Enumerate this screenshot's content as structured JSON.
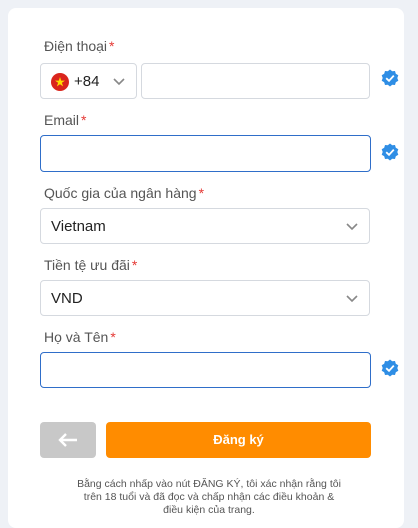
{
  "form": {
    "phone": {
      "label": "Điện thoại",
      "required_mark": "*",
      "country_code": "+84",
      "value": ""
    },
    "email": {
      "label": "Email",
      "required_mark": "*",
      "value": ""
    },
    "bank_country": {
      "label": "Quốc gia của ngân hàng",
      "required_mark": "*",
      "selected": "Vietnam"
    },
    "currency": {
      "label": "Tiền tệ ưu đãi",
      "required_mark": "*",
      "selected": "VND"
    },
    "full_name": {
      "label": "Họ và Tên",
      "required_mark": "*",
      "value": ""
    }
  },
  "actions": {
    "submit_label": "Đăng ký"
  },
  "footnote": "Bằng cách nhấp vào nút ĐĂNG KÝ, tôi xác nhận rằng tôi trên 18 tuổi và đã đọc và chấp nhận các điều khoản & điều kiện của trang.",
  "colors": {
    "accent": "#ff8c00",
    "check": "#2f8ee5",
    "required": "#e53935",
    "focus_border": "#2f6ec9"
  }
}
